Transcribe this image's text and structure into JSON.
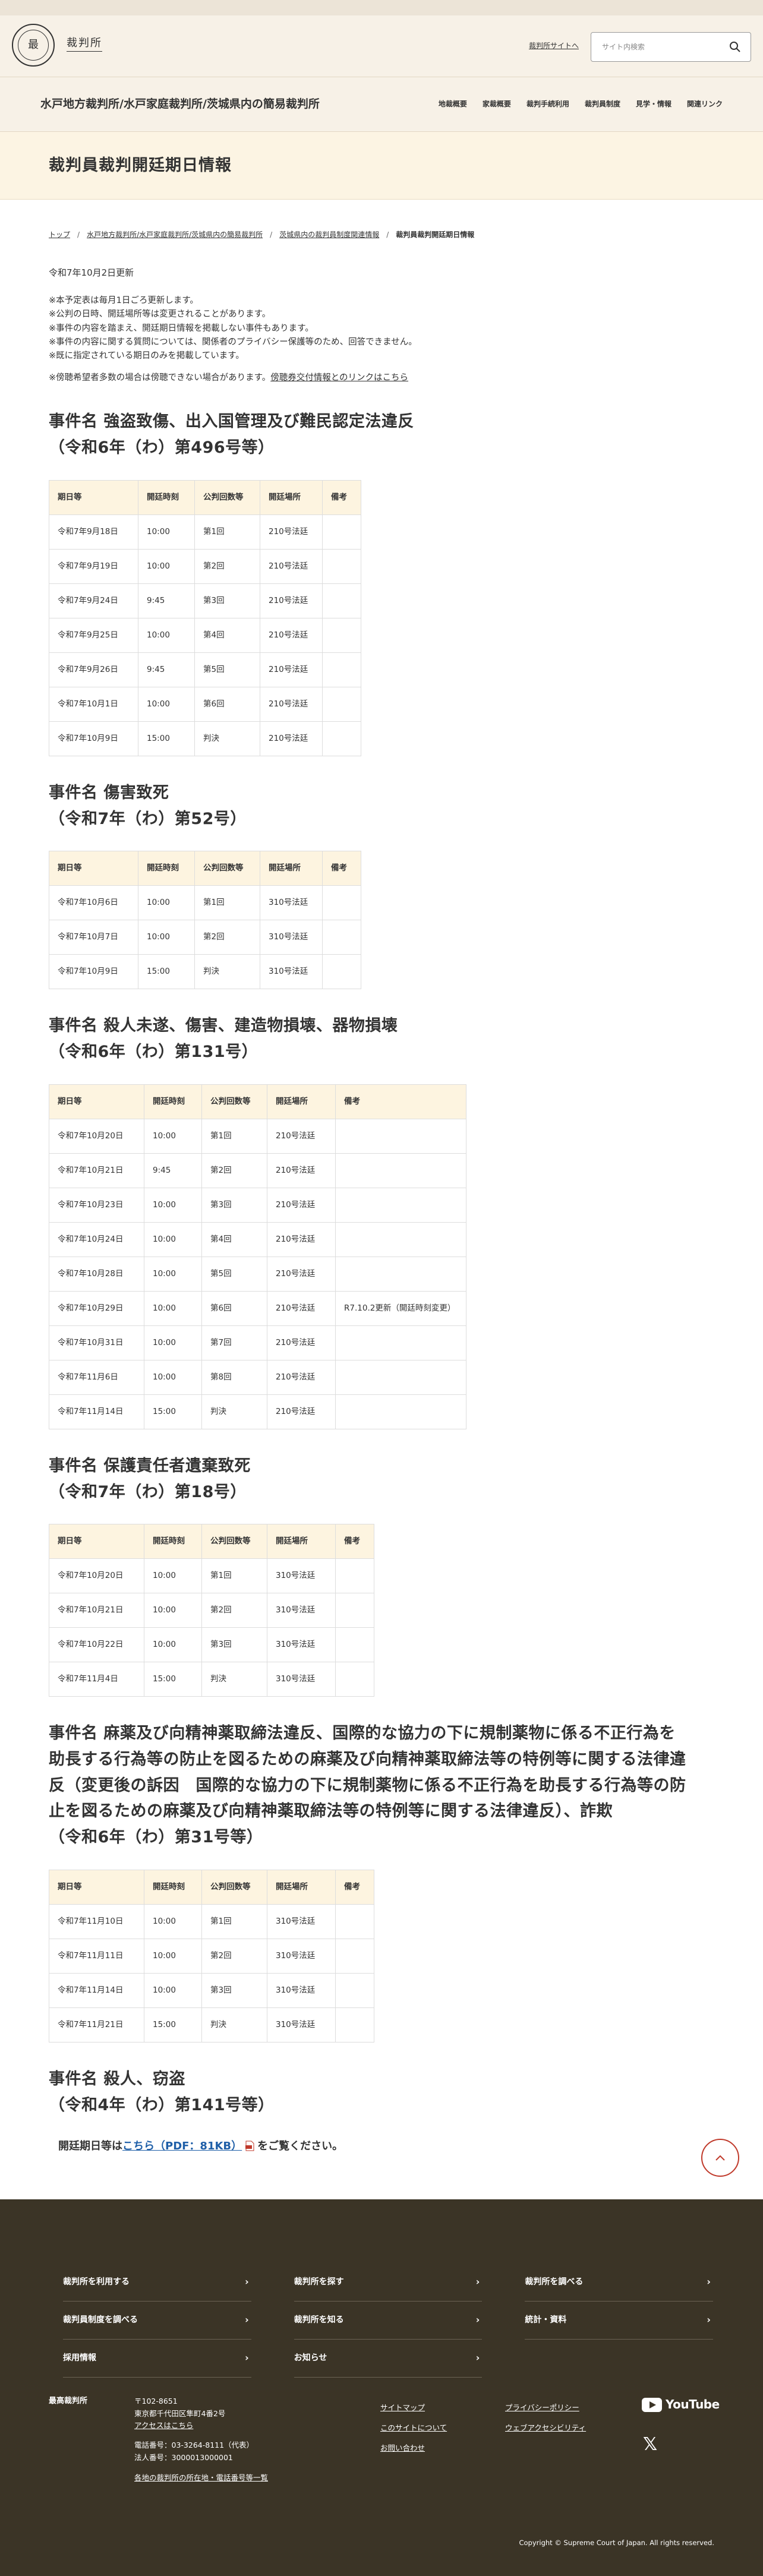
{
  "header": {
    "logo_text": "裁判所",
    "logo_seal": "最",
    "site_link": "裁判所サイトへ",
    "search_placeholder": "サイト内検索",
    "search_icon": "search-icon"
  },
  "nav": {
    "court_name": "水戸地方裁判所/水戸家庭裁判所/茨城県内の簡易裁判所",
    "items": [
      "地裁概要",
      "家裁概要",
      "裁判手続利用",
      "裁判員制度",
      "見学・情報",
      "関連リンク"
    ]
  },
  "page": {
    "title": "裁判員裁判開廷期日情報",
    "breadcrumb": [
      "トップ",
      "水戸地方裁判所/水戸家庭裁判所/茨城県内の簡易裁判所",
      "茨城県内の裁判員制度関連情報",
      "裁判員裁判開廷期日情報"
    ],
    "updated": "令和7年10月2日更新",
    "notes": [
      "※本予定表は毎月1日ごろ更新します。",
      "※公判の日時、開廷場所等は変更されることがあります。",
      "※事件の内容を踏まえ、開廷期日情報を掲載しない事件もあります。",
      "※事件の内容に関する質問については、関係者のプライバシー保護等のため、回答できません。",
      "※既に指定されている期日のみを掲載しています。"
    ],
    "lottery_note": "※傍聴希望者多数の場合は傍聴できない場合があります。",
    "lottery_link": "傍聴券交付情報とのリンクはこちら",
    "table_headers": [
      "期日等",
      "開廷時刻",
      "公判回数等",
      "開廷場所",
      "備考"
    ]
  },
  "cases": [
    {
      "title_line1": "事件名 強盗致傷、出入国管理及び難民認定法違反",
      "title_line2": "（令和6年（わ）第496号等）",
      "rows": [
        [
          "令和7年9月18日",
          "10:00",
          "第1回",
          "210号法廷",
          ""
        ],
        [
          "令和7年9月19日",
          "10:00",
          "第2回",
          "210号法廷",
          ""
        ],
        [
          "令和7年9月24日",
          "9:45",
          "第3回",
          "210号法廷",
          ""
        ],
        [
          "令和7年9月25日",
          "10:00",
          "第4回",
          "210号法廷",
          ""
        ],
        [
          "令和7年9月26日",
          "9:45",
          "第5回",
          "210号法廷",
          ""
        ],
        [
          "令和7年10月1日",
          "10:00",
          "第6回",
          "210号法廷",
          ""
        ],
        [
          "令和7年10月9日",
          "15:00",
          "判決",
          "210号法廷",
          ""
        ]
      ]
    },
    {
      "title_line1": "事件名 傷害致死",
      "title_line2": "（令和7年（わ）第52号）",
      "rows": [
        [
          "令和7年10月6日",
          "10:00",
          "第1回",
          "310号法廷",
          ""
        ],
        [
          "令和7年10月7日",
          "10:00",
          "第2回",
          "310号法廷",
          ""
        ],
        [
          "令和7年10月9日",
          "15:00",
          "判決",
          "310号法廷",
          ""
        ]
      ]
    },
    {
      "title_line1": "事件名 殺人未遂、傷害、建造物損壊、器物損壊",
      "title_line2": "（令和6年（わ）第131号）",
      "rows": [
        [
          "令和7年10月20日",
          "10:00",
          "第1回",
          "210号法廷",
          ""
        ],
        [
          "令和7年10月21日",
          "9:45",
          "第2回",
          "210号法廷",
          ""
        ],
        [
          "令和7年10月23日",
          "10:00",
          "第3回",
          "210号法廷",
          ""
        ],
        [
          "令和7年10月24日",
          "10:00",
          "第4回",
          "210号法廷",
          ""
        ],
        [
          "令和7年10月28日",
          "10:00",
          "第5回",
          "210号法廷",
          ""
        ],
        [
          "令和7年10月29日",
          "10:00",
          "第6回",
          "210号法廷",
          "R7.10.2更新（開廷時刻変更）"
        ],
        [
          "令和7年10月31日",
          "10:00",
          "第7回",
          "210号法廷",
          ""
        ],
        [
          "令和7年11月6日",
          "10:00",
          "第8回",
          "210号法廷",
          ""
        ],
        [
          "令和7年11月14日",
          "15:00",
          "判決",
          "210号法廷",
          ""
        ]
      ]
    },
    {
      "title_line1": "事件名 保護責任者遺棄致死",
      "title_line2": "（令和7年（わ）第18号）",
      "rows": [
        [
          "令和7年10月20日",
          "10:00",
          "第1回",
          "310号法廷",
          ""
        ],
        [
          "令和7年10月21日",
          "10:00",
          "第2回",
          "310号法廷",
          ""
        ],
        [
          "令和7年10月22日",
          "10:00",
          "第3回",
          "310号法廷",
          ""
        ],
        [
          "令和7年11月4日",
          "15:00",
          "判決",
          "310号法廷",
          ""
        ]
      ]
    },
    {
      "title_line1": "事件名 麻薬及び向精神薬取締法違反、国際的な協力の下に規制薬物に係る不正行為を",
      "title_line1b": "助長する行為等の防止を図るための麻薬及び向精神薬取締法等の特例等に関する法律違",
      "title_line1c": "反（変更後の訴因　国際的な協力の下に規制薬物に係る不正行為を助長する行為等の防",
      "title_line1d": "止を図るための麻薬及び向精神薬取締法等の特例等に関する法律違反）、詐欺",
      "title_line2": "（令和6年（わ）第31号等）",
      "rows": [
        [
          "令和7年11月10日",
          "10:00",
          "第1回",
          "310号法廷",
          ""
        ],
        [
          "令和7年11月11日",
          "10:00",
          "第2回",
          "310号法廷",
          ""
        ],
        [
          "令和7年11月14日",
          "10:00",
          "第3回",
          "310号法廷",
          ""
        ],
        [
          "令和7年11月21日",
          "15:00",
          "判決",
          "310号法廷",
          ""
        ]
      ]
    }
  ],
  "last_case": {
    "title_line1": "事件名 殺人、窃盗",
    "title_line2": "（令和4年（わ）第141号等）",
    "text_before": "開廷期日等は",
    "link": "こちら（PDF：81KB）",
    "text_after": "をご覧ください。"
  },
  "footer": {
    "nav": [
      "裁判所を利用する",
      "裁判所を探す",
      "裁判所を調べる",
      "裁判員制度を調べる",
      "裁判所を知る",
      "統計・資料",
      "採用情報",
      "お知らせ"
    ],
    "org": "最高裁判所",
    "postal": "〒102-8651",
    "address": "東京都千代田区隼町4番2号",
    "access": "アクセスはこちら",
    "phone": "電話番号：03-3264-8111（代表）",
    "corp_no": "法人番号：3000013000001",
    "court_list": "各地の裁判所の所在地・電話番号等一覧",
    "links_col1": [
      "サイトマップ",
      "このサイトについて",
      "お問い合わせ"
    ],
    "links_col2": [
      "プライバシーポリシー",
      "ウェブアクセシビリティ"
    ],
    "youtube": "YouTube",
    "x": "𝕏",
    "copyright": "Copyright © Supreme Court of Japan. All rights reserved."
  }
}
